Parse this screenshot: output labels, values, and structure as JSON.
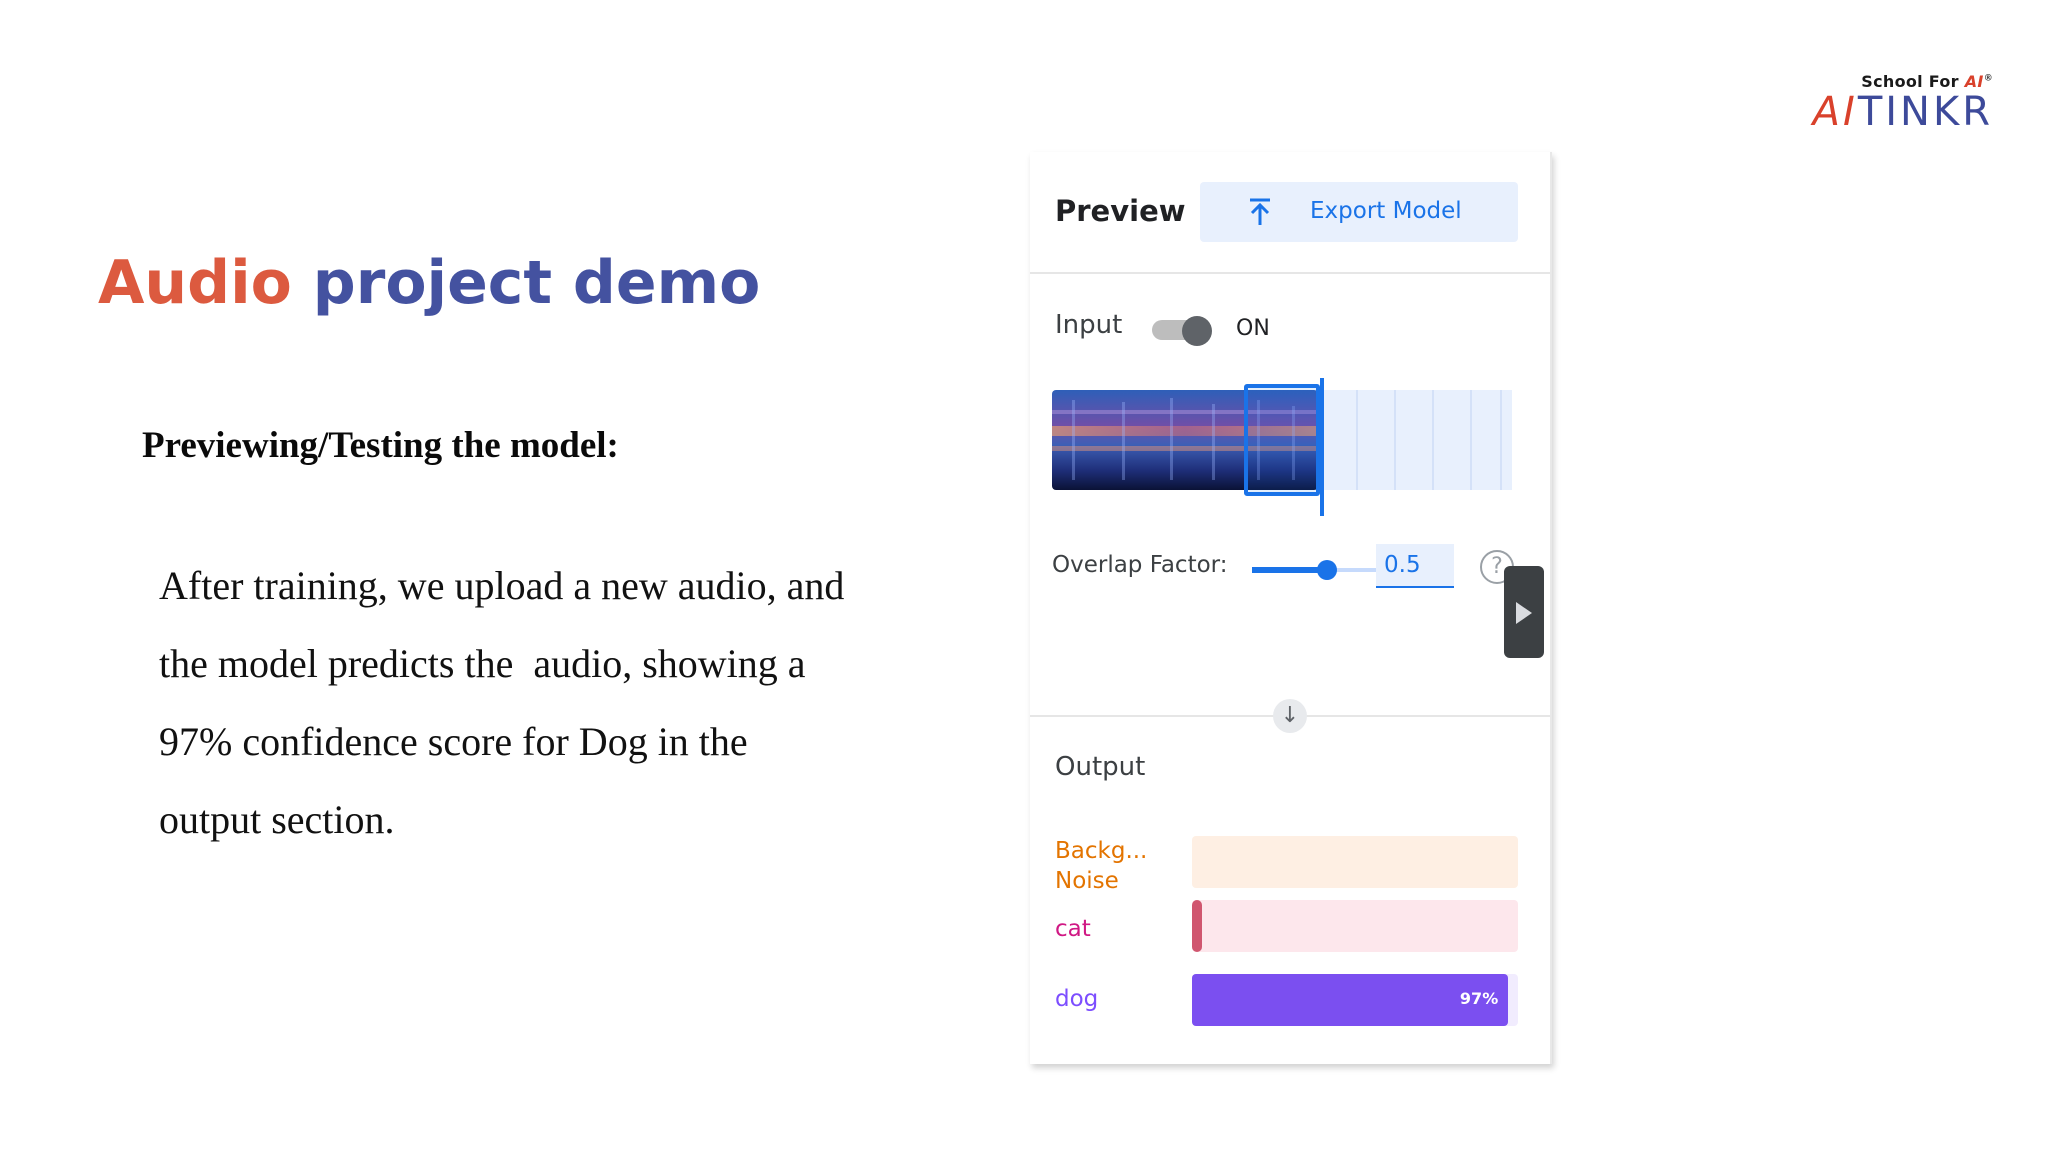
{
  "logo": {
    "tagline_prefix": "School For ",
    "tagline_ai": "AI",
    "wordmark_ai": "AI",
    "wordmark_rest": "TINKR",
    "colors": {
      "accent": "#d9412b",
      "brand": "#3d4a9a"
    }
  },
  "slide": {
    "title_part1": "Audio",
    "title_part2": " project demo",
    "subtitle": "Previewing/Testing the model:",
    "body_lines": [
      "After training, we upload a new audio, and",
      "the model predicts the  audio, showing a",
      "97% confidence score for Dog in the",
      "output section."
    ]
  },
  "panel": {
    "preview_label": "Preview",
    "export_button": "Export Model",
    "export_icon": "upload-icon",
    "input_label": "Input",
    "toggle_state": "ON",
    "toggle_on": true,
    "overlap_label": "Overlap Factor:",
    "overlap_value": "0.5",
    "overlap_level": 0.5,
    "help_icon": "?",
    "down_icon": "↓",
    "output_label": "Output",
    "outputs": [
      {
        "name_line1": "Backg...",
        "name_line2": "Noise",
        "confidence": 0,
        "color": "#e37400",
        "track": "#feefe3"
      },
      {
        "name_line1": "cat",
        "confidence": 0.02,
        "color": "#d0566f",
        "track": "#fde7ec"
      },
      {
        "name_line1": "dog",
        "confidence": 0.97,
        "percent_label": "97%",
        "color": "#7b4ff0",
        "track": "#f1ecfe"
      }
    ],
    "colors": {
      "accent_blue": "#1a73e8",
      "export_bg": "#e8f0fd"
    }
  }
}
